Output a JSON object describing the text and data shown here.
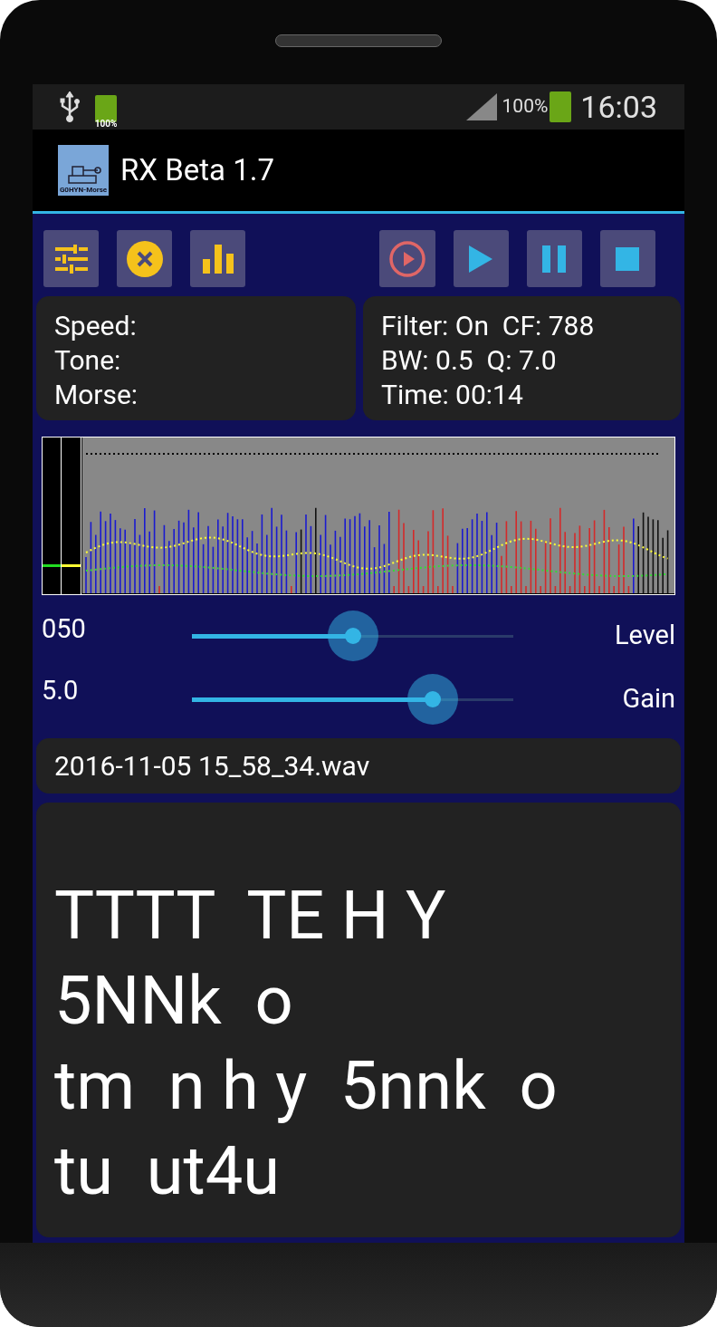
{
  "status_bar": {
    "battery_small": "100%",
    "battery": "100%",
    "time": "16:03"
  },
  "app_bar": {
    "logo_text": "G0HYN-Morse",
    "title": "RX Beta 1.7"
  },
  "toolbar": [
    {
      "kind": "sliders"
    },
    {
      "kind": "cancel"
    },
    {
      "kind": "bars"
    },
    {
      "kind": "record"
    },
    {
      "kind": "play"
    },
    {
      "kind": "pause"
    },
    {
      "kind": "stop"
    }
  ],
  "info_left": [
    "Speed:",
    "Tone:",
    "Morse:"
  ],
  "info_right": [
    "Filter: On  CF: 788",
    "BW: 0.5  Q: 7.0",
    "Time: 00:14"
  ],
  "sliders": [
    {
      "reading": "050",
      "label": "Level",
      "level": 0.5
    },
    {
      "reading": "5.0",
      "label": "Gain",
      "level": 0.75
    }
  ],
  "file_name": "2016-11-05 15_58_34.wav",
  "decoded_lines": [
    "TTTT  TE H Y",
    "5NNk  o",
    "tm  n h y  5nnk  o",
    "tu  ut4u"
  ]
}
